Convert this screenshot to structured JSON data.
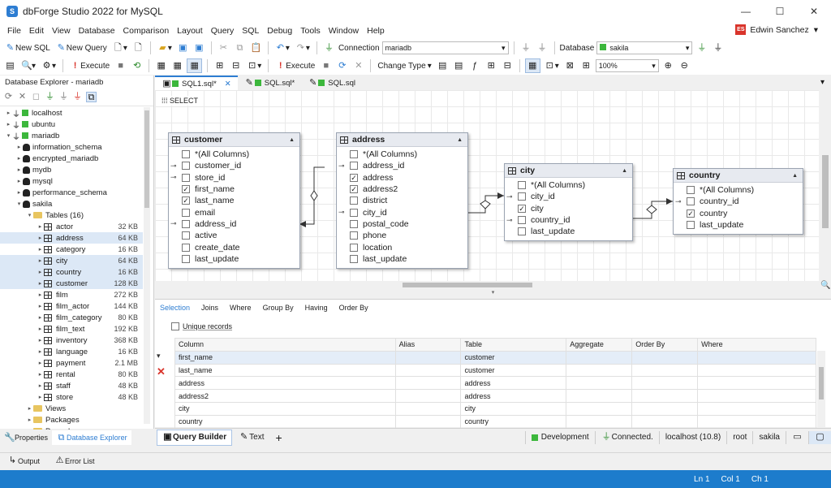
{
  "window": {
    "title": "dbForge Studio 2022 for MySQL",
    "logo": "S",
    "controls": [
      "—",
      "☐",
      "✕"
    ]
  },
  "menu": [
    "File",
    "Edit",
    "View",
    "Database",
    "Comparison",
    "Layout",
    "Query",
    "SQL",
    "Debug",
    "Tools",
    "Window",
    "Help"
  ],
  "user": {
    "initials": "ES",
    "name": "Edwin Sanchez"
  },
  "toolbar1": {
    "new_sql": "New SQL",
    "new_query": "New Query",
    "connection_label": "Connection",
    "connection_value": "mariadb",
    "database_label": "Database",
    "database_value": "sakila"
  },
  "toolbar2": {
    "execute": "Execute",
    "execute2": "Execute",
    "change_type": "Change Type",
    "zoom": "100%"
  },
  "db_explorer": {
    "title": "Database Explorer - mariadb",
    "tree": [
      {
        "level": 0,
        "type": "server",
        "label": "localhost",
        "exp": "▸"
      },
      {
        "level": 0,
        "type": "server",
        "label": "ubuntu",
        "exp": "▸"
      },
      {
        "level": 0,
        "type": "server",
        "label": "mariadb",
        "exp": "▾"
      },
      {
        "level": 1,
        "type": "db",
        "label": "information_schema",
        "exp": "▸"
      },
      {
        "level": 1,
        "type": "db",
        "label": "encrypted_mariadb",
        "exp": "▸"
      },
      {
        "level": 1,
        "type": "db",
        "label": "mydb",
        "exp": "▸"
      },
      {
        "level": 1,
        "type": "db",
        "label": "mysql",
        "exp": "▸"
      },
      {
        "level": 1,
        "type": "db",
        "label": "performance_schema",
        "exp": "▸"
      },
      {
        "level": 1,
        "type": "db",
        "label": "sakila",
        "exp": "▾"
      },
      {
        "level": 2,
        "type": "folder",
        "label": "Tables (16)",
        "exp": "▾"
      },
      {
        "level": 3,
        "type": "table",
        "label": "actor",
        "size": "32 KB",
        "exp": "▸"
      },
      {
        "level": 3,
        "type": "table",
        "label": "address",
        "size": "64 KB",
        "exp": "▸",
        "sel": true
      },
      {
        "level": 3,
        "type": "table",
        "label": "category",
        "size": "16 KB",
        "exp": "▸"
      },
      {
        "level": 3,
        "type": "table",
        "label": "city",
        "size": "64 KB",
        "exp": "▸",
        "sel": true
      },
      {
        "level": 3,
        "type": "table",
        "label": "country",
        "size": "16 KB",
        "exp": "▸",
        "sel": true
      },
      {
        "level": 3,
        "type": "table",
        "label": "customer",
        "size": "128 KB",
        "exp": "▸",
        "sel": true
      },
      {
        "level": 3,
        "type": "table",
        "label": "film",
        "size": "272 KB",
        "exp": "▸"
      },
      {
        "level": 3,
        "type": "table",
        "label": "film_actor",
        "size": "144 KB",
        "exp": "▸"
      },
      {
        "level": 3,
        "type": "table",
        "label": "film_category",
        "size": "80 KB",
        "exp": "▸"
      },
      {
        "level": 3,
        "type": "table",
        "label": "film_text",
        "size": "192 KB",
        "exp": "▸"
      },
      {
        "level": 3,
        "type": "table",
        "label": "inventory",
        "size": "368 KB",
        "exp": "▸"
      },
      {
        "level": 3,
        "type": "table",
        "label": "language",
        "size": "16 KB",
        "exp": "▸"
      },
      {
        "level": 3,
        "type": "table",
        "label": "payment",
        "size": "2.1 MB",
        "exp": "▸"
      },
      {
        "level": 3,
        "type": "table",
        "label": "rental",
        "size": "80 KB",
        "exp": "▸"
      },
      {
        "level": 3,
        "type": "table",
        "label": "staff",
        "size": "48 KB",
        "exp": "▸"
      },
      {
        "level": 3,
        "type": "table",
        "label": "store",
        "size": "48 KB",
        "exp": "▸"
      },
      {
        "level": 2,
        "type": "folder",
        "label": "Views",
        "exp": "▸"
      },
      {
        "level": 2,
        "type": "folder",
        "label": "Packages",
        "exp": "▸"
      },
      {
        "level": 2,
        "type": "folder",
        "label": "Procedures",
        "exp": "▸"
      }
    ]
  },
  "doc_tabs": [
    {
      "label": "SQL1.sql*",
      "active": true,
      "close": "✕"
    },
    {
      "label": "SQL.sql*",
      "active": false
    },
    {
      "label": "SQL.sql",
      "active": false
    }
  ],
  "canvas": {
    "select_tag": "SELECT",
    "entities": [
      {
        "name": "customer",
        "rows": [
          {
            "label": "*(All Columns)",
            "checked": false
          },
          {
            "label": "customer_id",
            "checked": false,
            "key": true
          },
          {
            "label": "store_id",
            "checked": false,
            "key": true
          },
          {
            "label": "first_name",
            "checked": true
          },
          {
            "label": "last_name",
            "checked": true
          },
          {
            "label": "email",
            "checked": false
          },
          {
            "label": "address_id",
            "checked": false,
            "key": true
          },
          {
            "label": "active",
            "checked": false
          },
          {
            "label": "create_date",
            "checked": false
          },
          {
            "label": "last_update",
            "checked": false
          }
        ]
      },
      {
        "name": "address",
        "rows": [
          {
            "label": "*(All Columns)",
            "checked": false
          },
          {
            "label": "address_id",
            "checked": false,
            "key": true
          },
          {
            "label": "address",
            "checked": true
          },
          {
            "label": "address2",
            "checked": true
          },
          {
            "label": "district",
            "checked": false
          },
          {
            "label": "city_id",
            "checked": false,
            "key": true
          },
          {
            "label": "postal_code",
            "checked": false
          },
          {
            "label": "phone",
            "checked": false
          },
          {
            "label": "location",
            "checked": false
          },
          {
            "label": "last_update",
            "checked": false
          }
        ]
      },
      {
        "name": "city",
        "rows": [
          {
            "label": "*(All Columns)",
            "checked": false
          },
          {
            "label": "city_id",
            "checked": false,
            "key": true
          },
          {
            "label": "city",
            "checked": true
          },
          {
            "label": "country_id",
            "checked": false,
            "key": true
          },
          {
            "label": "last_update",
            "checked": false
          }
        ]
      },
      {
        "name": "country",
        "rows": [
          {
            "label": "*(All Columns)",
            "checked": false
          },
          {
            "label": "country_id",
            "checked": false,
            "key": true
          },
          {
            "label": "country",
            "checked": true
          },
          {
            "label": "last_update",
            "checked": false
          }
        ]
      }
    ]
  },
  "qb_tabs": [
    "Selection",
    "Joins",
    "Where",
    "Group By",
    "Having",
    "Order By"
  ],
  "unique_records": "Unique records",
  "grid": {
    "headers": [
      "Column",
      "Alias",
      "Table",
      "Aggregate",
      "Order By",
      "Where"
    ],
    "rows": [
      [
        "first_name",
        "",
        "customer",
        "",
        "",
        ""
      ],
      [
        "last_name",
        "",
        "customer",
        "",
        "",
        ""
      ],
      [
        "address",
        "",
        "address",
        "",
        "",
        ""
      ],
      [
        "address2",
        "",
        "address",
        "",
        "",
        ""
      ],
      [
        "city",
        "",
        "city",
        "",
        "",
        ""
      ],
      [
        "country",
        "",
        "country",
        "",
        "",
        ""
      ]
    ]
  },
  "bottom_tabs": {
    "query_builder": "Query Builder",
    "text": "Text",
    "add": "+"
  },
  "conn_status": {
    "env": "Development",
    "state": "Connected.",
    "host": "localhost (10.8)",
    "user": "root",
    "db": "sakila"
  },
  "left_tabs": {
    "properties": "Properties",
    "explorer": "Database Explorer"
  },
  "output_tabs": {
    "output": "Output",
    "errors": "Error List"
  },
  "status": {
    "ln": "Ln 1",
    "col": "Col 1",
    "ch": "Ch 1"
  },
  "colors": {
    "accent": "#2d7dd2",
    "status_bar": "#1d7ccc",
    "green": "#3cb73c",
    "error": "#d9342b"
  }
}
